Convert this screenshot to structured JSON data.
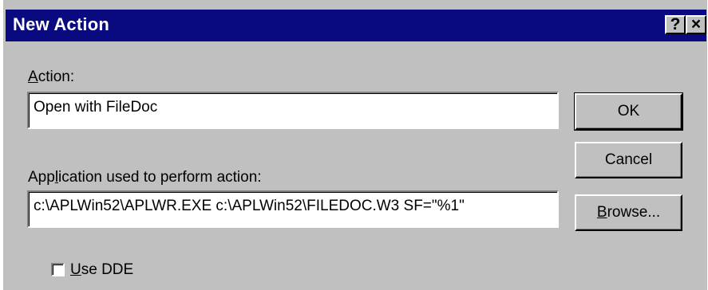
{
  "window": {
    "title": "New Action",
    "help_glyph": "?",
    "close_glyph": "×"
  },
  "action": {
    "label_accel": "A",
    "label_rest": "ction:",
    "value": "Open with FileDoc"
  },
  "application": {
    "label_pre": "App",
    "label_accel": "l",
    "label_post": "ication used to perform action:",
    "value": "c:\\APLWin52\\APLWR.EXE c:\\APLWin52\\FILEDOC.W3 SF=\"%1\""
  },
  "buttons": {
    "ok": "OK",
    "cancel": "Cancel",
    "browse_accel": "B",
    "browse_rest": "rowse..."
  },
  "dde": {
    "label_accel": "U",
    "label_rest": "se DDE",
    "checked": false
  },
  "colors": {
    "titlebar": "#0a0a80",
    "face": "#c0c0c0"
  },
  "icons": [
    "help-icon",
    "close-icon"
  ]
}
